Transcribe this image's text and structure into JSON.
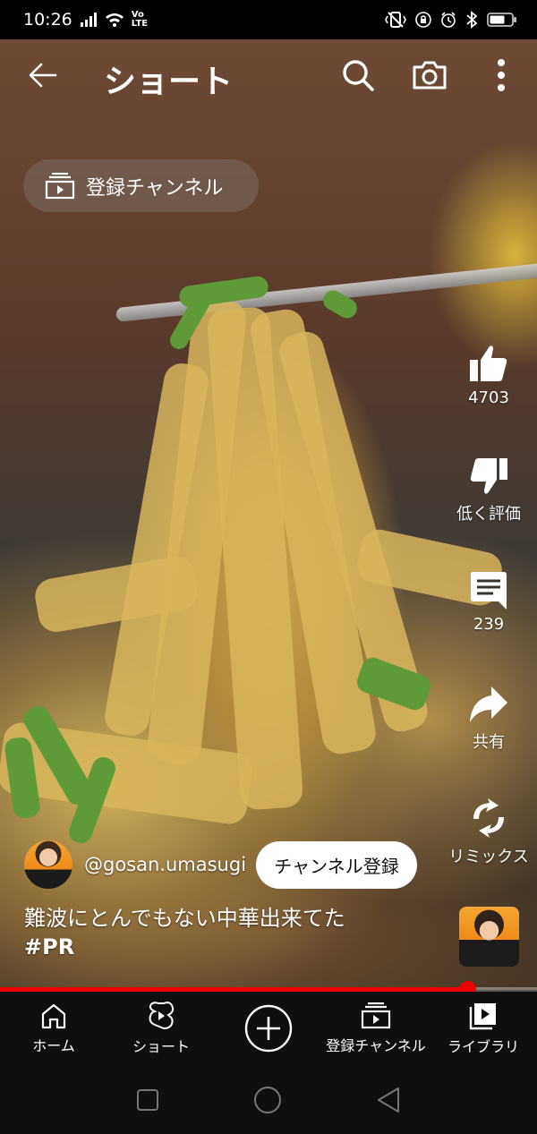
{
  "status_bar": {
    "time": "10:26",
    "left_icons": [
      "signal-icon",
      "wifi-icon",
      "volte-icon"
    ],
    "volte_label": "Vo LTE",
    "right_icons": [
      "vibrate-icon",
      "lock-rotation-icon",
      "alarm-icon",
      "bluetooth-icon",
      "battery-icon"
    ]
  },
  "header": {
    "title": "ショート",
    "icons": [
      "back-arrow-icon",
      "search-icon",
      "camera-icon",
      "more-vert-icon"
    ]
  },
  "subscriptions_chip": {
    "label": "登録チャンネル",
    "icon": "subscriptions-icon"
  },
  "actions": {
    "like": {
      "icon": "thumb-up-icon",
      "label": "4703"
    },
    "dislike": {
      "icon": "thumb-down-icon",
      "label": "低く評価"
    },
    "comments": {
      "icon": "comment-icon",
      "label": "239"
    },
    "share": {
      "icon": "share-icon",
      "label": "共有"
    },
    "remix": {
      "icon": "remix-icon",
      "label": "リミックス"
    }
  },
  "channel": {
    "handle": "@gosan.umasugi",
    "subscribe_label": "チャンネル登録"
  },
  "video": {
    "title": "難波にとんでもない中華出来てた",
    "hashtag": "#PR",
    "progress": 0.87
  },
  "colors": {
    "accent": "#ff0000",
    "nav_background": "#0f0f0f"
  },
  "bottom_nav": {
    "items": [
      {
        "label": "ホーム",
        "icon": "home-icon"
      },
      {
        "label": "ショート",
        "icon": "shorts-icon"
      },
      {
        "label": "",
        "icon": "create-plus-icon"
      },
      {
        "label": "登録チャンネル",
        "icon": "subscriptions-icon"
      },
      {
        "label": "ライブラリ",
        "icon": "library-icon"
      }
    ]
  },
  "android_nav": [
    "recent-apps-icon",
    "home-circle-icon",
    "back-triangle-icon"
  ]
}
